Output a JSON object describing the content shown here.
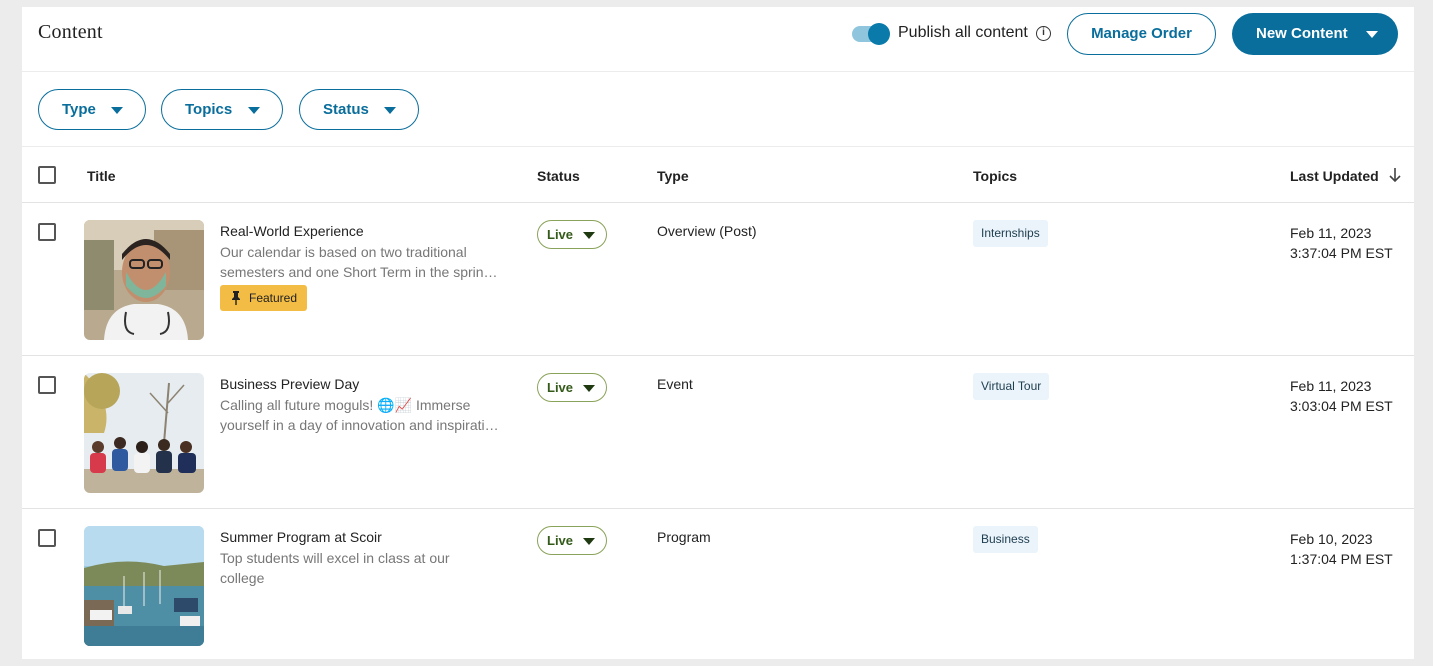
{
  "header": {
    "title": "Content",
    "publish_label": "Publish all content",
    "publish_enabled": true,
    "manage_order_label": "Manage Order",
    "new_content_label": "New Content",
    "accent_color": "#0a6e9c"
  },
  "filters": {
    "type_label": "Type",
    "topics_label": "Topics",
    "status_label": "Status"
  },
  "table": {
    "columns": {
      "title": "Title",
      "status": "Status",
      "type": "Type",
      "topics": "Topics",
      "last_updated": "Last Updated"
    },
    "sort": "last_updated-descending",
    "rows": [
      {
        "title": "Real-World Experience",
        "desc_line1": "Our calendar is based on two traditional",
        "desc_line2": "semesters and one Short Term in the spring…",
        "featured_label": "Featured",
        "status": "Live",
        "type": "Overview (Post)",
        "topic": "Internships",
        "date": "Feb 11, 2023",
        "time": "3:37:04 PM EST"
      },
      {
        "title": "Business Preview Day",
        "desc_line1": "Calling all future moguls! 🌐📈 Immerse",
        "desc_line2": "yourself in a day of innovation and inspiration…",
        "status": "Live",
        "type": "Event",
        "topic": "Virtual Tour",
        "date": "Feb 11, 2023",
        "time": "3:03:04 PM EST"
      },
      {
        "title": "Summer Program at Scoir",
        "desc_line1": "Top students will excel in class at our",
        "desc_line2": "college",
        "status": "Live",
        "type": "Program",
        "topic": "Business",
        "date": "Feb 10, 2023",
        "time": "1:37:04 PM EST"
      }
    ]
  }
}
